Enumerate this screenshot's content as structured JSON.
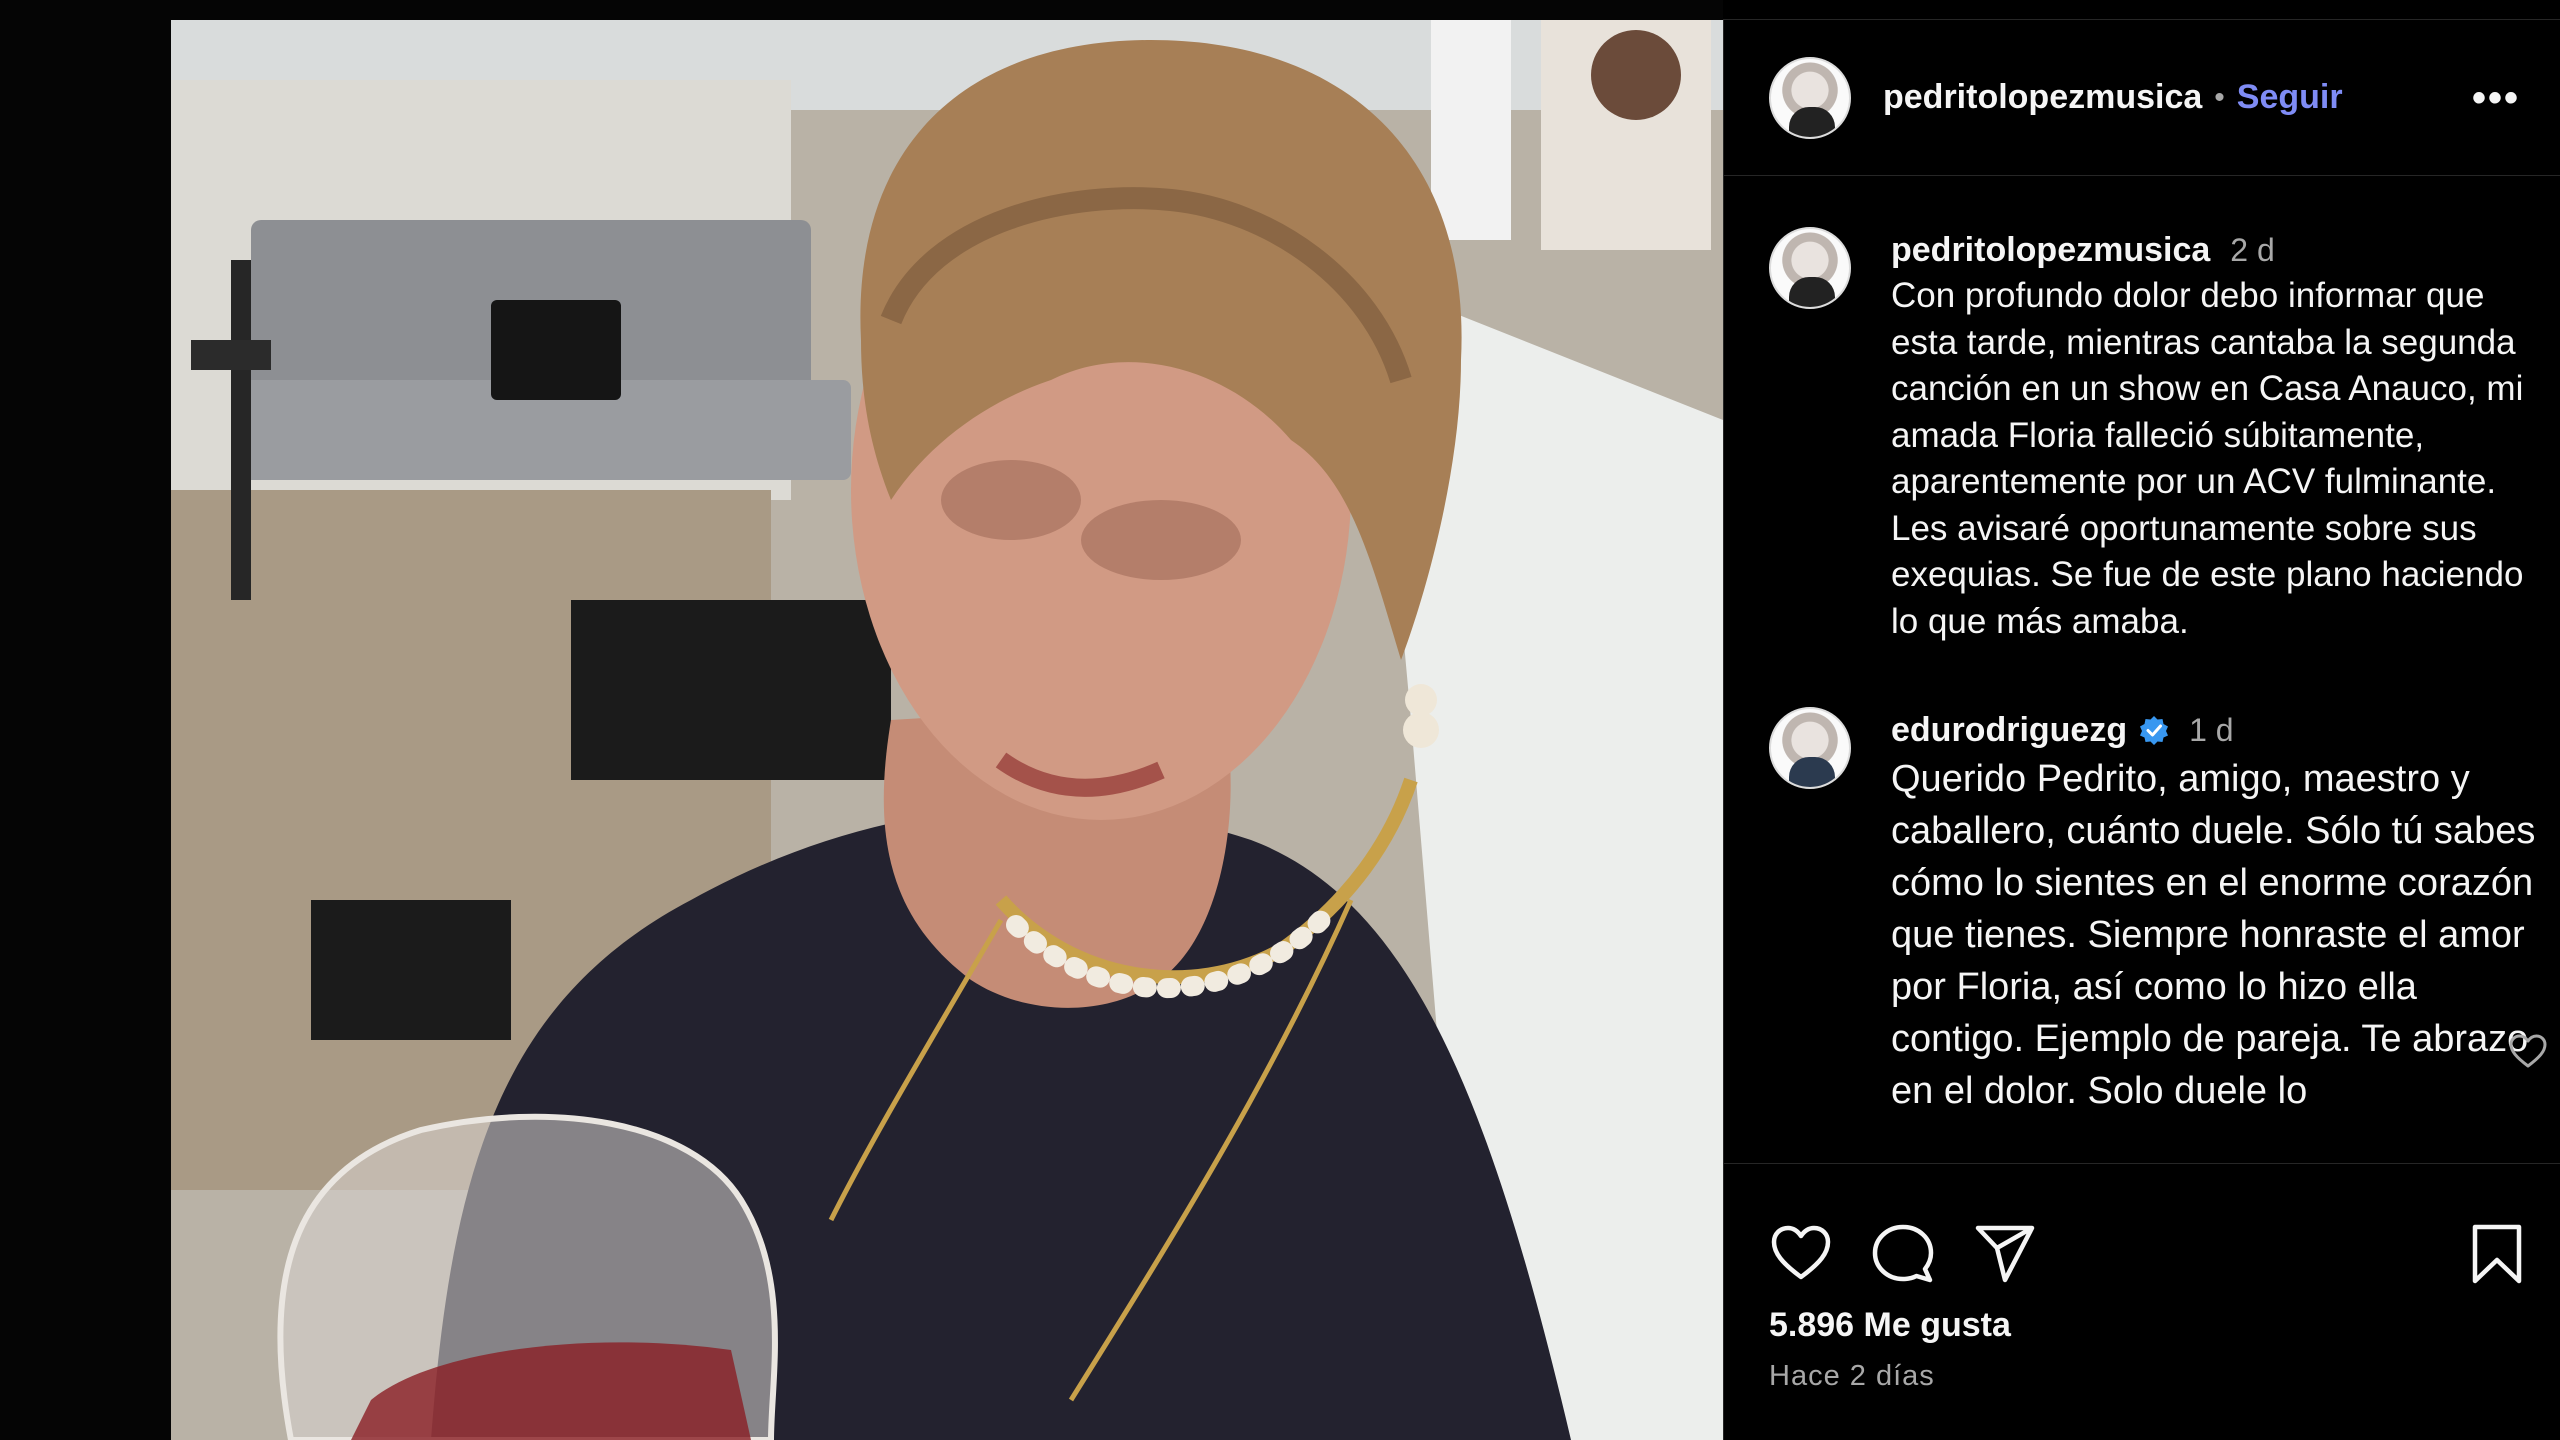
{
  "post": {
    "username": "pedritolopezmusica",
    "separator": "•",
    "follow_label": "Seguir",
    "more_label": "•••"
  },
  "caption": {
    "username": "pedritolopezmusica",
    "time": "2 d",
    "text": "Con profundo dolor debo informar que esta tarde, mientras cantaba la segunda canción en un show en Casa Anauco, mi amada Floria falleció súbitamente, aparentemente por un ACV fulminante. Les avisaré oportunamente sobre sus exequias. Se fue de este plano haciendo lo que más amaba."
  },
  "comments": [
    {
      "username": "edurodriguezg",
      "verified": true,
      "time": "1 d",
      "text": "Querido Pedrito, amigo, maestro y caballero, cuánto duele. Sólo tú sabes cómo lo sientes en el enorme corazón que tienes. Siempre honraste el amor por Floria, así como lo hizo ella contigo. Ejemplo de pareja. Te abrazo en el dolor. Solo duele lo"
    }
  ],
  "actions": {
    "like_icon": "heart-icon",
    "comment_icon": "comment-icon",
    "share_icon": "send-icon",
    "save_icon": "bookmark-icon"
  },
  "likes_text": "5.896 Me gusta",
  "date_text": "Hace 2 días",
  "colors": {
    "background": "#000000",
    "follow": "#7f8cf5",
    "secondary_text": "#a8a8a8",
    "verified": "#3897f0"
  }
}
